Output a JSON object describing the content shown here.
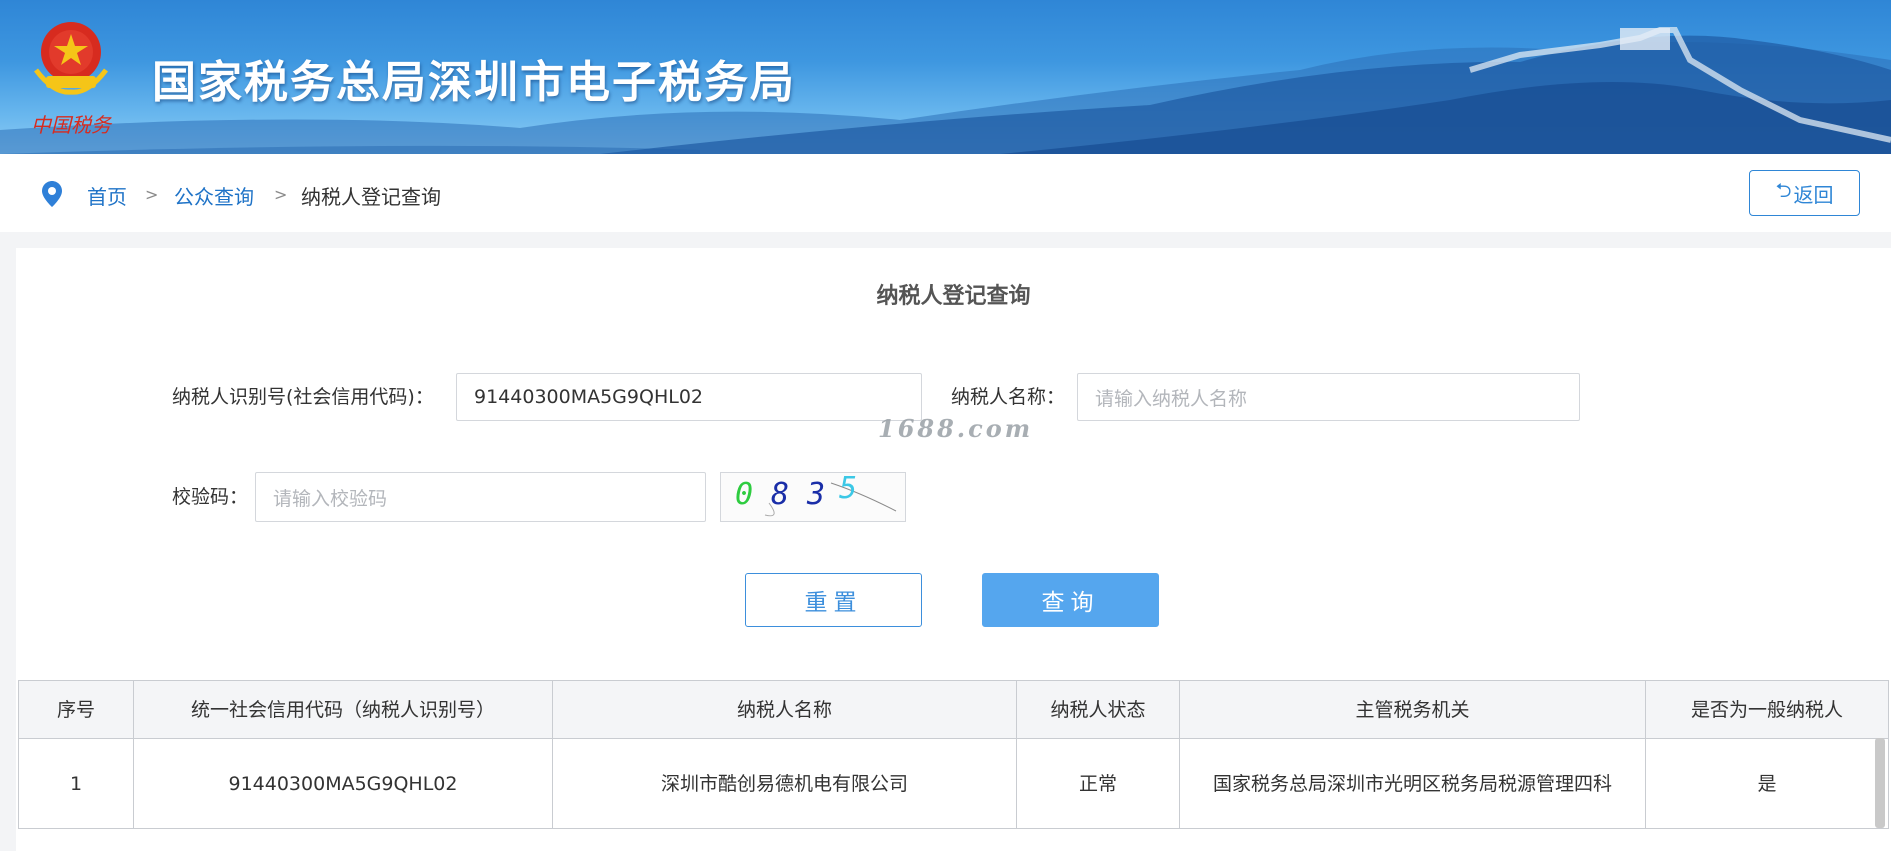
{
  "header": {
    "emblem_caption": "中国税务",
    "site_title": "国家税务总局深圳市电子税务局"
  },
  "breadcrumb": {
    "items": [
      "首页",
      "公众查询",
      "纳税人登记查询"
    ],
    "separator": ">",
    "back_label": "返回"
  },
  "form": {
    "title": "纳税人登记查询",
    "taxpayer_id_label": "纳税人识别号(社会信用代码)：",
    "taxpayer_id_value": "91440300MA5G9QHL02",
    "taxpayer_name_label": "纳税人名称：",
    "taxpayer_name_placeholder": "请输入纳税人名称",
    "captcha_label": "校验码：",
    "captcha_placeholder": "请输入校验码",
    "captcha_chars": [
      "0",
      "8",
      "3",
      "5"
    ],
    "reset_label": "重置",
    "query_label": "查询"
  },
  "watermark": "1688.com",
  "table": {
    "headers": [
      "序号",
      "统一社会信用代码（纳税人识别号）",
      "纳税人名称",
      "纳税人状态",
      "主管税务机关",
      "是否为一般纳税人"
    ],
    "rows": [
      [
        "1",
        "91440300MA5G9QHL02",
        "深圳市酷创易德机电有限公司",
        "正常",
        "国家税务总局深圳市光明区税务局税源管理四科",
        "是"
      ]
    ]
  },
  "colors": {
    "banner": "#3e97e0",
    "link": "#1f73c7",
    "primary_button": "#55a6ee"
  }
}
